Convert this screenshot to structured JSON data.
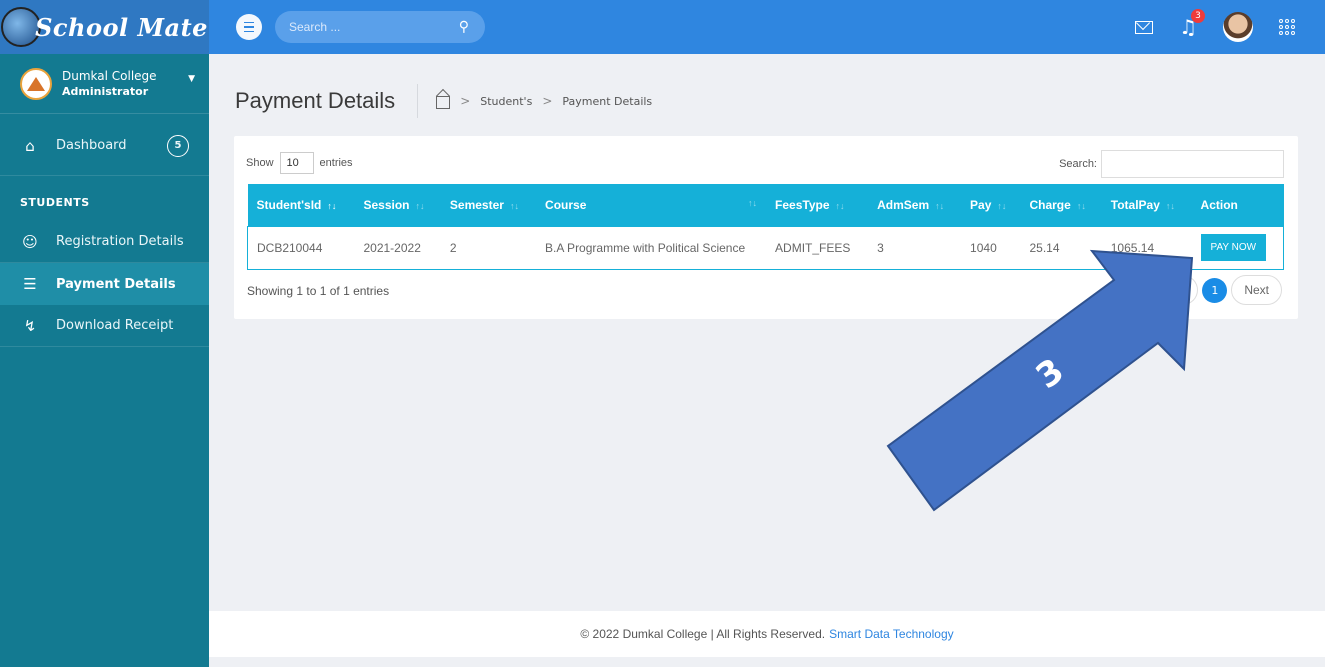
{
  "brand": {
    "logo_text": "School Mate"
  },
  "org": {
    "name": "Dumkal College",
    "role": "Administrator"
  },
  "sidebar": {
    "dashboard": {
      "label": "Dashboard",
      "badge": "5"
    },
    "section_title": "STUDENTS",
    "items": [
      {
        "label": "Registration Details",
        "icon": "users-icon"
      },
      {
        "label": "Payment Details",
        "icon": "coins-icon",
        "active": true
      },
      {
        "label": "Download Receipt",
        "icon": "download-icon"
      }
    ]
  },
  "topbar": {
    "search_placeholder": "Search ...",
    "notification_count": "3"
  },
  "page": {
    "title": "Payment Details",
    "breadcrumb": [
      "Student's",
      "Payment Details"
    ]
  },
  "table_controls": {
    "show": "Show",
    "entries_value": "10",
    "entries": "entries",
    "search_label": "Search:"
  },
  "table": {
    "columns": [
      "Student'sId",
      "Session",
      "Semester",
      "Course",
      "FeesType",
      "AdmSem",
      "Pay",
      "Charge",
      "TotalPay",
      "Action"
    ],
    "rows": [
      {
        "student_id": "DCB210044",
        "session": "2021-2022",
        "semester": "2",
        "course": "B.A Programme with Political Science",
        "fees_type": "ADMIT_FEES",
        "adm_sem": "3",
        "pay": "1040",
        "charge": "25.14",
        "total_pay": "1065.14",
        "action": "PAY NOW"
      }
    ]
  },
  "pagination": {
    "info": "Showing 1 to 1 of 1 entries",
    "current": "1",
    "next": "Next"
  },
  "footer": {
    "text": "© 2022 Dumkal College | All Rights Reserved.",
    "link": "Smart Data Technology"
  },
  "annotation": {
    "step_number": "3",
    "arrow_color": "#4472c4"
  }
}
